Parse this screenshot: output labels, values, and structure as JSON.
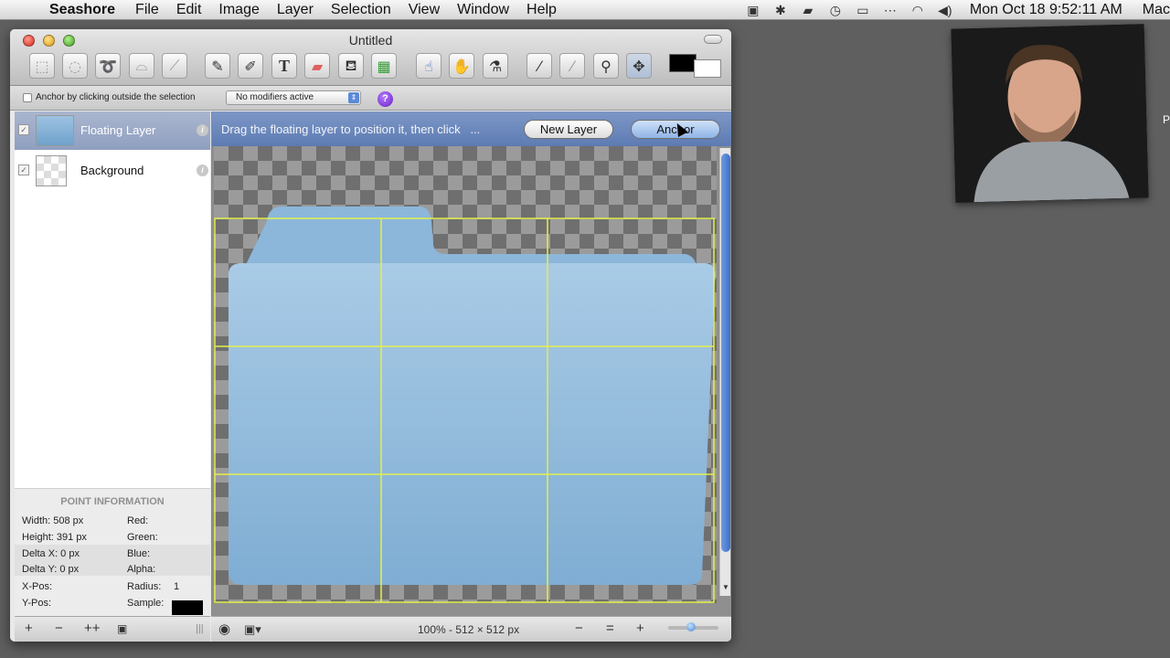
{
  "menubar": {
    "app_name": "Seashore",
    "menus": [
      "File",
      "Edit",
      "Image",
      "Layer",
      "Selection",
      "View",
      "Window",
      "Help"
    ],
    "clock": "Mon Oct 18  9:52:11 AM",
    "host": "Mac"
  },
  "window": {
    "title": "Untitled",
    "tools": [
      "rect-select",
      "ellipse-select",
      "lasso",
      "polygon-lasso",
      "wand",
      "pencil",
      "brush",
      "text",
      "eraser",
      "bucket",
      "gradient",
      "smudge",
      "clone",
      "effect",
      "eyedropper",
      "brush-2",
      "zoom",
      "move"
    ]
  },
  "options": {
    "anchor_checkbox_label": "Anchor by clicking outside the selection",
    "modifiers_value": "No modifiers active",
    "help_label": "?"
  },
  "layers": [
    {
      "name": "Floating Layer",
      "visible": true
    },
    {
      "name": "Background",
      "visible": true
    }
  ],
  "point_info": {
    "title": "POINT INFORMATION",
    "width": "Width:   508 px",
    "height": "Height:  391 px",
    "delta_x": "Delta X: 0 px",
    "delta_y": "Delta Y: 0 px",
    "x_pos": "X-Pos:",
    "y_pos": "Y-Pos:",
    "red": "Red:",
    "green": "Green:",
    "blue": "Blue:",
    "alpha": "Alpha:",
    "radius_label": "Radius:",
    "radius_value": "1",
    "sample_label": "Sample:",
    "sample_color": "#000000"
  },
  "floating_banner": {
    "message": "Drag the floating layer to position it, then click",
    "ellipsis": "...",
    "new_layer_label": "New Layer",
    "anchor_label": "Anchor"
  },
  "status": {
    "zoom_info": "100% - 512 × 512 px"
  },
  "edge_text": "P"
}
